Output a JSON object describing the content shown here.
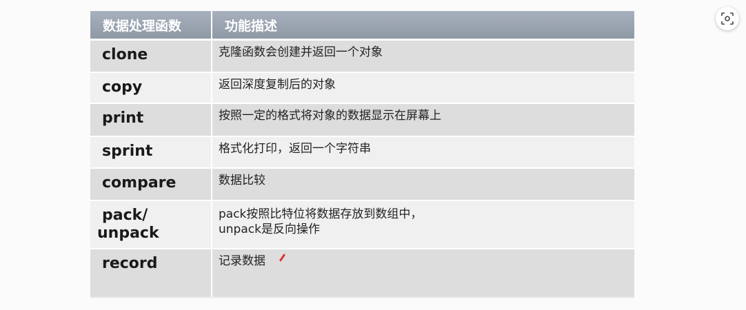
{
  "table": {
    "headers": [
      "数据处理函数",
      "功能描述"
    ],
    "rows": [
      {
        "name": "clone",
        "desc": [
          "克隆函数会创建并返回一个对象"
        ]
      },
      {
        "name": "copy",
        "desc": [
          "返回深度复制后的对象"
        ]
      },
      {
        "name": "print",
        "desc": [
          "按照一定的格式将对象的数据显示在屏幕上"
        ]
      },
      {
        "name": "sprint",
        "desc": [
          "格式化打印，返回一个字符串"
        ]
      },
      {
        "name": "compare",
        "desc": [
          "数据比较"
        ]
      },
      {
        "name": [
          "pack/",
          "unpack"
        ],
        "desc": [
          "pack按照比特位将数据存放到数组中，",
          "unpack是反向操作"
        ]
      },
      {
        "name": "record",
        "desc": [
          "记录数据"
        ]
      }
    ]
  },
  "icons": {
    "scan": "scan-icon",
    "pen": "pen-icon"
  },
  "colors": {
    "header_bg": "#99a3af",
    "row_dark": "#dddddd",
    "row_light": "#f0f0f0"
  }
}
